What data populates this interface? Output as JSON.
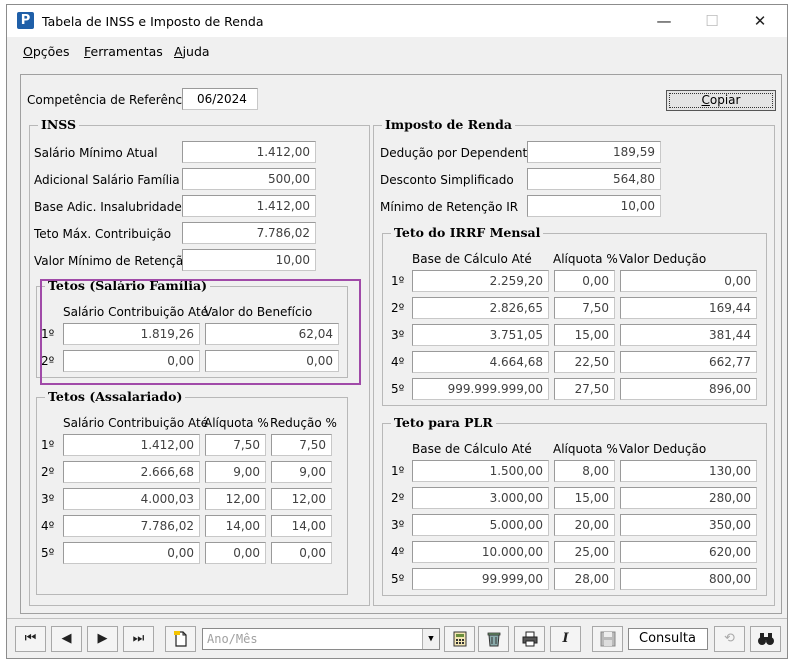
{
  "window": {
    "title": "Tabela de INSS e Imposto de Renda",
    "app_icon": "P"
  },
  "controls": {
    "minimize": "—",
    "maximize": "☐",
    "close": "✕"
  },
  "menu": [
    {
      "label": "Opções",
      "underline": "O",
      "rest": "pções"
    },
    {
      "label": "Ferramentas",
      "underline": "F",
      "rest": "erramentas"
    },
    {
      "label": "Ajuda",
      "underline": "A",
      "rest": "juda"
    }
  ],
  "competencia": {
    "label": "Competência de Referência",
    "value": "06/2024"
  },
  "copy_button": {
    "underline": "C",
    "rest": "opiar"
  },
  "inss": {
    "title": "INSS",
    "rows": [
      {
        "label": "Salário Mínimo Atual",
        "value": "1.412,00"
      },
      {
        "label": "Adicional Salário Família",
        "value": "500,00"
      },
      {
        "label": "Base Adic. Insalubridade",
        "value": "1.412,00"
      },
      {
        "label": "Teto Máx. Contribuição",
        "value": "7.786,02"
      },
      {
        "label": "Valor Mínimo de Retenção",
        "value": "10,00"
      }
    ]
  },
  "tetos_familia": {
    "title": "Tetos (Salário Família)",
    "col1": "Salário Contribuição Até",
    "col2": "Valor do Benefício",
    "rows": [
      {
        "n": "1º",
        "a": "1.819,26",
        "b": "62,04"
      },
      {
        "n": "2º",
        "a": "0,00",
        "b": "0,00"
      }
    ]
  },
  "tetos_assalariado": {
    "title": "Tetos (Assalariado)",
    "col1": "Salário Contribuição Até",
    "col2": "Alíquota %",
    "col3": "Redução %",
    "rows": [
      {
        "n": "1º",
        "a": "1.412,00",
        "b": "7,50",
        "c": "7,50"
      },
      {
        "n": "2º",
        "a": "2.666,68",
        "b": "9,00",
        "c": "9,00"
      },
      {
        "n": "3º",
        "a": "4.000,03",
        "b": "12,00",
        "c": "12,00"
      },
      {
        "n": "4º",
        "a": "7.786,02",
        "b": "14,00",
        "c": "14,00"
      },
      {
        "n": "5º",
        "a": "0,00",
        "b": "0,00",
        "c": "0,00"
      }
    ]
  },
  "ir": {
    "title": "Imposto de Renda",
    "rows": [
      {
        "label": "Dedução por Dependente",
        "value": "189,59"
      },
      {
        "label": "Desconto Simplificado",
        "value": "564,80"
      },
      {
        "label": "Mínimo de Retenção IR",
        "value": "10,00"
      }
    ]
  },
  "irrf": {
    "title": "Teto do IRRF Mensal",
    "col1": "Base de Cálculo Até",
    "col2": "Alíquota %",
    "col3": "Valor Dedução",
    "rows": [
      {
        "n": "1º",
        "a": "2.259,20",
        "b": "0,00",
        "c": "0,00"
      },
      {
        "n": "2º",
        "a": "2.826,65",
        "b": "7,50",
        "c": "169,44"
      },
      {
        "n": "3º",
        "a": "3.751,05",
        "b": "15,00",
        "c": "381,44"
      },
      {
        "n": "4º",
        "a": "4.664,68",
        "b": "22,50",
        "c": "662,77"
      },
      {
        "n": "5º",
        "a": "999.999.999,00",
        "b": "27,50",
        "c": "896,00"
      }
    ]
  },
  "plr": {
    "title": "Teto para PLR",
    "col1": "Base de Cálculo Até",
    "col2": "Alíquota %",
    "col3": "Valor Dedução",
    "rows": [
      {
        "n": "1º",
        "a": "1.500,00",
        "b": "8,00",
        "c": "130,00"
      },
      {
        "n": "2º",
        "a": "3.000,00",
        "b": "15,00",
        "c": "280,00"
      },
      {
        "n": "3º",
        "a": "5.000,00",
        "b": "20,00",
        "c": "350,00"
      },
      {
        "n": "4º",
        "a": "10.000,00",
        "b": "25,00",
        "c": "620,00"
      },
      {
        "n": "5º",
        "a": "99.999,00",
        "b": "28,00",
        "c": "800,00"
      }
    ]
  },
  "toolbar": {
    "first": "⏮",
    "prev": "◀",
    "next": "▶",
    "last": "⏭",
    "combo_placeholder": "Ano/Mês",
    "italic": "I",
    "mode": "Consulta"
  }
}
